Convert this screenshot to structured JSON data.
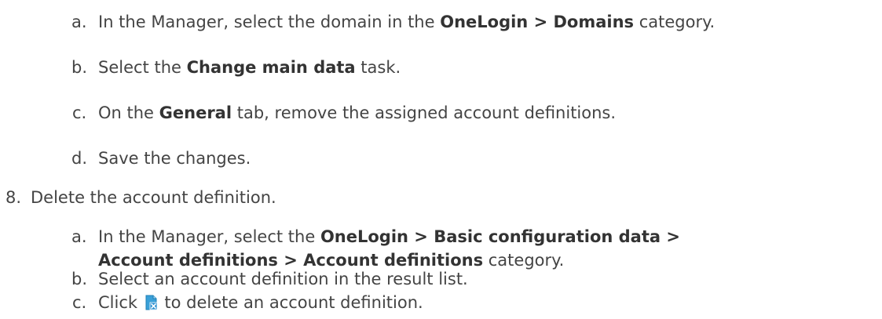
{
  "steps_prev": [
    {
      "marker": "a.",
      "parts": [
        {
          "t": "In the Manager, select the domain in the ",
          "b": false
        },
        {
          "t": "OneLogin > Domains",
          "b": true
        },
        {
          "t": " category.",
          "b": false
        }
      ]
    },
    {
      "marker": "b.",
      "parts": [
        {
          "t": "Select the ",
          "b": false
        },
        {
          "t": "Change main data",
          "b": true
        },
        {
          "t": " task.",
          "b": false
        }
      ]
    },
    {
      "marker": "c.",
      "parts": [
        {
          "t": "On the ",
          "b": false
        },
        {
          "t": "General",
          "b": true
        },
        {
          "t": " tab, remove the assigned account definitions.",
          "b": false
        }
      ]
    },
    {
      "marker": "d.",
      "parts": [
        {
          "t": "Save the changes.",
          "b": false
        }
      ]
    }
  ],
  "step8": {
    "marker": "8.",
    "text": "Delete the account definition.",
    "substeps": [
      {
        "marker": "a.",
        "line1": [
          {
            "t": "In the Manager, select the ",
            "b": false
          },
          {
            "t": "OneLogin > Basic configuration data >",
            "b": true
          }
        ],
        "line2": [
          {
            "t": "Account definitions > Account definitions",
            "b": true
          },
          {
            "t": " category.",
            "b": false
          }
        ]
      },
      {
        "marker": "b.",
        "text": "Select an account definition in the result list."
      },
      {
        "marker": "c.",
        "before_icon": "Click ",
        "icon": "delete-object-icon",
        "after_icon": " to delete an account definition."
      }
    ]
  }
}
